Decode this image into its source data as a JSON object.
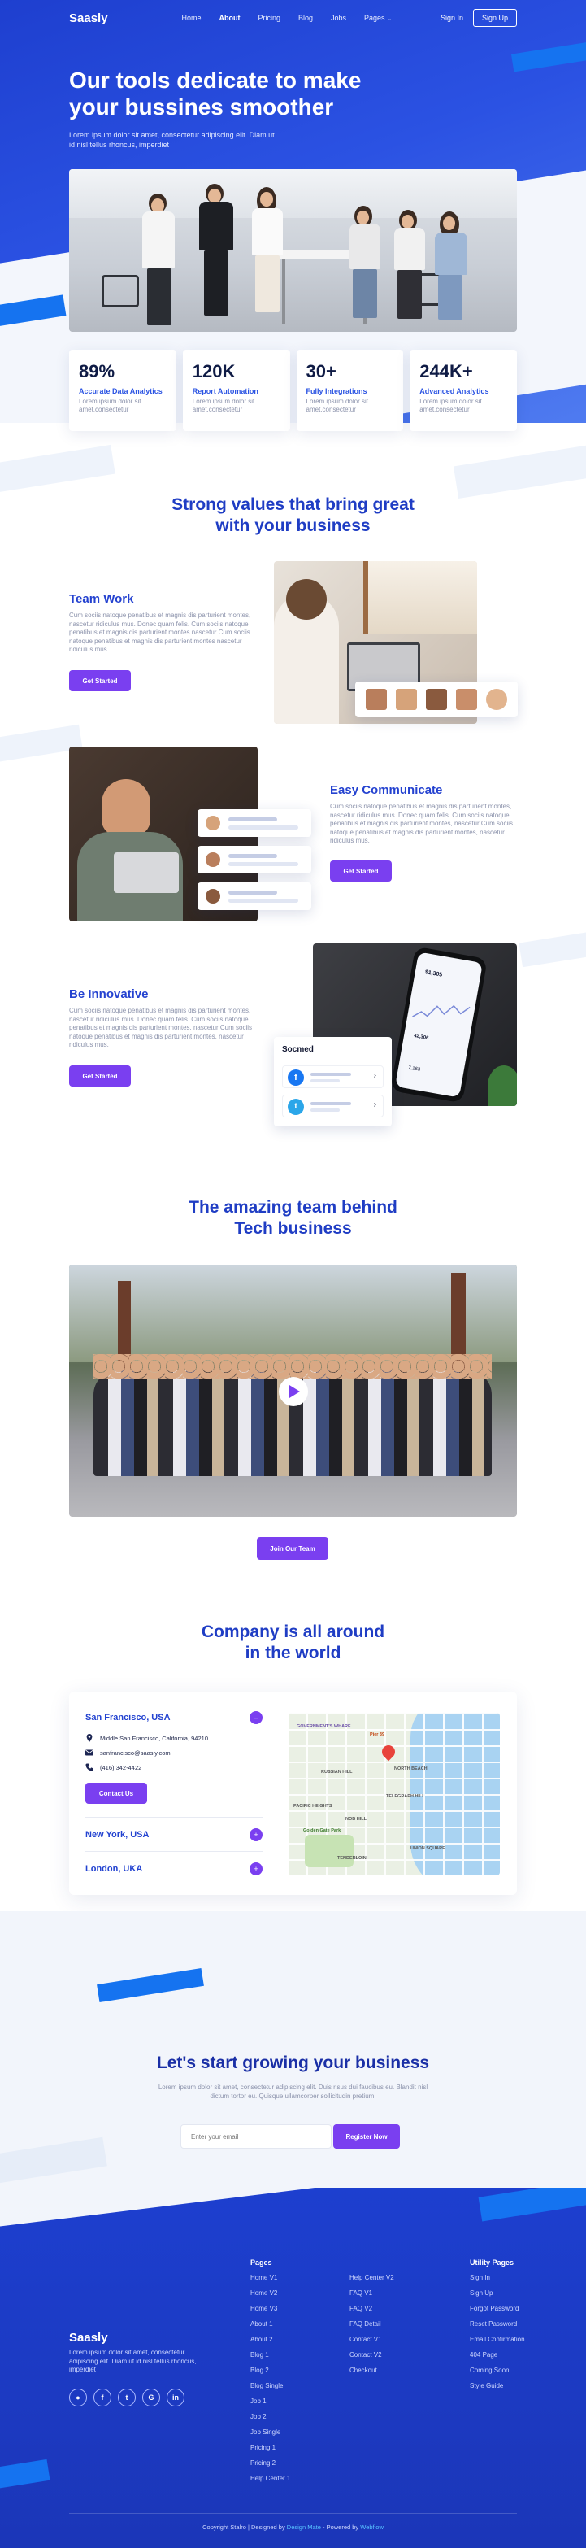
{
  "brand": "Saasly",
  "nav": {
    "links": [
      "Home",
      "About",
      "Pricing",
      "Blog",
      "Jobs",
      "Pages"
    ],
    "signin": "Sign In",
    "signup": "Sign Up"
  },
  "hero": {
    "title": "Our tools dedicate to make your bussines smoother",
    "subtitle": "Lorem ipsum dolor sit amet, consectetur adipiscing elit. Diam ut id nisl tellus rhoncus, imperdiet"
  },
  "stats": [
    {
      "value": "89%",
      "label": "Accurate Data Analytics",
      "desc": "Lorem ipsum dolor sit amet,consectetur"
    },
    {
      "value": "120K",
      "label": "Report Automation",
      "desc": "Lorem ipsum dolor sit amet,consectetur"
    },
    {
      "value": "30+",
      "label": "Fully Integrations",
      "desc": "Lorem ipsum dolor sit amet,consectetur"
    },
    {
      "value": "244K+",
      "label": "Advanced Analytics",
      "desc": "Lorem ipsum dolor sit amet,consectetur"
    }
  ],
  "values_section": {
    "title_line1": "Strong values that bring great",
    "title_line2": "with your business"
  },
  "features": [
    {
      "title": "Team Work",
      "desc": "Cum sociis natoque penatibus et magnis dis parturient montes, nascetur ridiculus mus. Donec quam felis. Cum sociis natoque penatibus et magnis dis parturient montes nascetur Cum sociis natoque penatibus et magnis dis parturient montes nascetur ridiculus mus.",
      "button": "Get Started"
    },
    {
      "title": "Easy Communicate",
      "desc": "Cum sociis natoque penatibus et magnis dis parturient montes, nascetur ridiculus mus. Donec quam felis. Cum sociis natoque penatibus et magnis dis parturient montes, nascetur Cum sociis natoque penatibus et magnis dis parturient montes, nascetur ridiculus mus.",
      "button": "Get Started"
    },
    {
      "title": "Be Innovative",
      "desc": "Cum sociis natoque penatibus et magnis dis parturient montes, nascetur ridiculus mus. Donec quam felis. Cum sociis natoque penatibus et magnis dis parturient montes, nascetur Cum sociis natoque penatibus et magnis dis parturient montes, nascetur ridiculus mus.",
      "button": "Get Started"
    }
  ],
  "socmed_card": {
    "title": "Socmed"
  },
  "phone": {
    "amount": "$1,305",
    "amount2": "42,306",
    "bottom": "7,163"
  },
  "team_section": {
    "title_line1": "The amazing team behind",
    "title_line2": "Tech business",
    "button": "Join Our Team"
  },
  "locations_section": {
    "title_line1": "Company is all around",
    "title_line2": "in the world",
    "items": [
      {
        "city": "San Francisco, USA",
        "address": "Middle San Francisco, California, 94210",
        "email": "sanfrancisco@saasly.com",
        "phone": "(416) 342-4422",
        "button": "Contact Us",
        "expanded_icon": "–"
      },
      {
        "city": "New York, USA",
        "toggle_icon": "+"
      },
      {
        "city": "London, UKA",
        "toggle_icon": "+"
      }
    ]
  },
  "map_labels": {
    "a": "GOVERNMENT'S WHARF",
    "b": "RUSSIAN HILL",
    "c": "TELEGRAPH HILL",
    "d": "NORTH BEACH",
    "e": "PACIFIC HEIGHTS",
    "f": "NOB HILL",
    "g": "TENDERLOIN",
    "h": "UNION SQUARE",
    "i": "Pier 39",
    "j": "Golden Gate Park"
  },
  "cta": {
    "title": "Let's start growing your business",
    "subtitle": "Lorem ipsum dolor sit amet, consectetur adipiscing elit. Duis risus dui faucibus eu. Blandit nisl dictum tortor eu. Quisque ullamcorper sollicitudin pretium.",
    "placeholder": "Enter your email",
    "button": "Register Now"
  },
  "footer": {
    "brand": "Saasly",
    "desc": "Lorem ipsum dolor sit amet, consectetur adipiscing elit. Diam ut id nisl tellus rhoncus, imperdiet",
    "social": [
      "globe",
      "facebook",
      "twitter",
      "google",
      "linkedin"
    ],
    "pages_head": "Pages",
    "pages_col1": [
      "Home V1",
      "Home V2",
      "Home V3",
      "About 1",
      "About 2",
      "Blog 1",
      "Blog 2",
      "Blog Single",
      "Job 1",
      "Job 2",
      "Job Single",
      "Pricing 1",
      "Pricing 2",
      "Help Center 1"
    ],
    "pages_col2": [
      "Help Center V2",
      "FAQ V1",
      "FAQ V2",
      "FAQ Detail",
      "Contact V1",
      "Contact V2",
      "Checkout"
    ],
    "utility_head": "Utility Pages",
    "utility": [
      "Sign In",
      "Sign Up",
      "Forgot Password",
      "Reset Password",
      "Email Confirmation",
      "404 Page",
      "Coming Soon",
      "Style Guide"
    ],
    "copy_prefix": "Copyright ",
    "copy_brand": "Stalro",
    "copy_mid": " | Designed by ",
    "copy_designer": "Design Mate",
    "copy_powered": " - Powered by ",
    "copy_webflow": "Webflow"
  }
}
